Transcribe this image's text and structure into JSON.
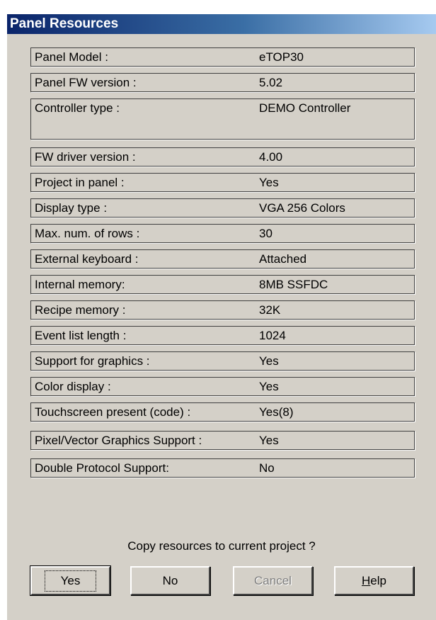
{
  "dialog": {
    "title": "Panel Resources",
    "prompt": "Copy resources to current project ?"
  },
  "rows": [
    {
      "label": "Panel Model :",
      "value": "eTOP30"
    },
    {
      "label": "Panel FW version :",
      "value": "5.02"
    },
    {
      "label": "Controller type :",
      "value": "DEMO Controller"
    },
    {
      "label": "FW driver version :",
      "value": "4.00"
    },
    {
      "label": "Project in panel :",
      "value": "Yes"
    },
    {
      "label": "Display type :",
      "value": "VGA 256 Colors"
    },
    {
      "label": "Max. num. of rows :",
      "value": "30"
    },
    {
      "label": "External keyboard :",
      "value": "Attached"
    },
    {
      "label": "Internal memory:",
      "value": "8MB SSFDC"
    },
    {
      "label": "Recipe memory :",
      "value": "32K"
    },
    {
      "label": "Event list length :",
      "value": "1024"
    },
    {
      "label": "Support for graphics :",
      "value": "Yes"
    },
    {
      "label": "Color display :",
      "value": "Yes"
    },
    {
      "label": "Touchscreen present (code) :",
      "value": "Yes(8)"
    },
    {
      "label": "Pixel/Vector Graphics Support :",
      "value": "Yes"
    },
    {
      "label": "Double Protocol Support:",
      "value": "No"
    }
  ],
  "buttons": {
    "yes": "Yes",
    "no": "No",
    "cancel": "Cancel",
    "help_mnemonic": "H",
    "help_rest": "elp"
  }
}
